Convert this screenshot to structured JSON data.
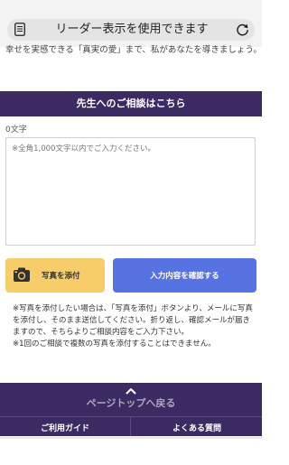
{
  "reader_bar": {
    "text": "リーダー表示を使用できます",
    "doc_icon": "document-icon",
    "reload_icon": "reload-icon"
  },
  "intro": {
    "text": "幸せを実感できる「真実の愛」まで、私があなたを導きましょう。"
  },
  "consult": {
    "title": "先生へのご相談はこちら",
    "char_count": "0文字",
    "textarea_placeholder": "※全角1,000文字以内でご入力ください。",
    "textarea_value": ""
  },
  "buttons": {
    "attach_label": "写真を添付",
    "attach_icon": "camera-icon",
    "confirm_label": "入力内容を確認する"
  },
  "notes": [
    "※写真を添付したい場合は、「写真を添付」ボタンより、メールに写真を添付し、そのまま送信してください。折り返し、確認メールが届きますので、そちらよりご相談内容をご入力下さい。",
    "※1回のご相談で複数の写真を添付することはできません。"
  ],
  "back_to_top": {
    "label": "ページトップへ戻る",
    "icon": "chevron-up-icon"
  },
  "footer": {
    "guide": "ご利用ガイド",
    "faq": "よくある質問"
  },
  "colors": {
    "header_purple": "#3c2a63",
    "attach_yellow": "#f7cd6a",
    "confirm_blue": "#5773e2"
  }
}
